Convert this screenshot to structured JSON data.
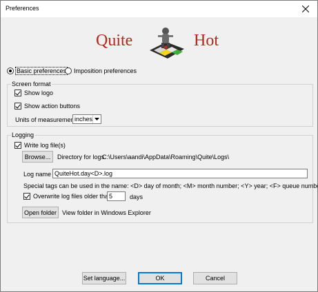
{
  "window": {
    "title": "Preferences"
  },
  "logo": {
    "left_word": "Quite",
    "right_word": "Hot"
  },
  "mode": {
    "basic_label": "Basic preferences",
    "imposition_label": "Imposition preferences"
  },
  "screen_format": {
    "legend": "Screen format",
    "show_logo_label": "Show logo",
    "show_action_buttons_label": "Show action buttons",
    "units_label": "Units of measurement",
    "units_value": "inches"
  },
  "logging": {
    "legend": "Logging",
    "write_log_label": "Write log file(s)",
    "browse_label": "Browse...",
    "directory_label": "Directory for logs",
    "directory_value": "C:\\Users\\aandi\\AppData\\Roaming\\Quite\\Logs\\",
    "log_name_label": "Log name",
    "log_name_value": "QuiteHot.day<D>.log",
    "tags_help": "Special tags can be used in the name: <D> day of month; <M> month number; <Y> year; <F> queue number",
    "overwrite_label": "Overwrite log files older than",
    "overwrite_days_value": "5",
    "days_label": "days",
    "open_folder_label": "Open folder",
    "open_folder_help": "View folder in Windows Explorer"
  },
  "footer": {
    "set_language_label": "Set language...",
    "ok_label": "OK",
    "cancel_label": "Cancel"
  }
}
